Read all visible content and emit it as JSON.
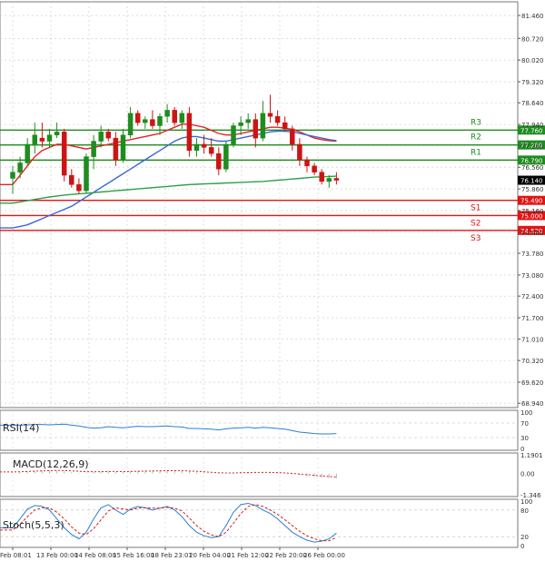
{
  "chart_data": {
    "type": "candlestick",
    "price_axis": {
      "ticks": [
        "81.460",
        "80.720",
        "80.020",
        "79.320",
        "78.640",
        "77.940",
        "77.260",
        "76.560",
        "75.860",
        "75.160",
        "74.460",
        "73.780",
        "73.080",
        "72.400",
        "71.700",
        "71.010",
        "70.320",
        "69.620",
        "68.940"
      ],
      "range": [
        68.94,
        81.46
      ]
    },
    "time_axis": {
      "labels": [
        "Feb 08:01",
        "13 Feb 00:00",
        "14 Feb 08:00",
        "15 Feb 16:00",
        "18 Feb 23:01",
        "20 Feb 04:00",
        "21 Feb 12:00",
        "22 Feb 20:00",
        "26 Feb 00:00"
      ]
    },
    "levels": [
      {
        "name": "R3",
        "value": 77.76,
        "label": "77.760",
        "color": "#1f8c1f"
      },
      {
        "name": "R2",
        "value": 77.28,
        "label": "77.280",
        "color": "#1f8c1f"
      },
      {
        "name": "R1",
        "value": 76.79,
        "label": "76.790",
        "color": "#1f8c1f"
      },
      {
        "name": "S1",
        "value": 75.49,
        "label": "75.490",
        "color": "#e01414"
      },
      {
        "name": "S2",
        "value": 75.0,
        "label": "75.000",
        "color": "#e01414"
      },
      {
        "name": "S3",
        "value": 74.52,
        "label": "74.520",
        "color": "#e01414"
      }
    ],
    "current_price": {
      "value": 76.14,
      "label": "76.140"
    },
    "candles": [
      {
        "o": 76.2,
        "h": 76.6,
        "l": 75.7,
        "c": 76.4
      },
      {
        "o": 76.4,
        "h": 76.9,
        "l": 76.2,
        "c": 76.7
      },
      {
        "o": 76.7,
        "h": 77.5,
        "l": 76.6,
        "c": 77.3
      },
      {
        "o": 77.3,
        "h": 78.0,
        "l": 77.0,
        "c": 77.6
      },
      {
        "o": 77.5,
        "h": 78.0,
        "l": 77.2,
        "c": 77.4
      },
      {
        "o": 77.4,
        "h": 77.8,
        "l": 77.2,
        "c": 77.6
      },
      {
        "o": 77.6,
        "h": 78.0,
        "l": 77.5,
        "c": 77.7
      },
      {
        "o": 77.7,
        "h": 77.8,
        "l": 76.1,
        "c": 76.3
      },
      {
        "o": 76.3,
        "h": 76.5,
        "l": 75.9,
        "c": 76.0
      },
      {
        "o": 76.0,
        "h": 76.2,
        "l": 75.7,
        "c": 75.8
      },
      {
        "o": 75.8,
        "h": 77.0,
        "l": 75.7,
        "c": 76.9
      },
      {
        "o": 76.9,
        "h": 77.6,
        "l": 76.5,
        "c": 77.4
      },
      {
        "o": 77.4,
        "h": 77.9,
        "l": 77.2,
        "c": 77.7
      },
      {
        "o": 77.7,
        "h": 77.8,
        "l": 77.4,
        "c": 77.5
      },
      {
        "o": 77.5,
        "h": 77.7,
        "l": 76.6,
        "c": 76.8
      },
      {
        "o": 76.8,
        "h": 77.8,
        "l": 76.7,
        "c": 77.6
      },
      {
        "o": 77.6,
        "h": 78.5,
        "l": 77.5,
        "c": 78.3
      },
      {
        "o": 78.3,
        "h": 78.4,
        "l": 77.9,
        "c": 78.0
      },
      {
        "o": 78.0,
        "h": 78.2,
        "l": 77.8,
        "c": 78.1
      },
      {
        "o": 78.1,
        "h": 78.4,
        "l": 77.8,
        "c": 77.9
      },
      {
        "o": 77.9,
        "h": 78.3,
        "l": 77.6,
        "c": 78.2
      },
      {
        "o": 78.2,
        "h": 78.6,
        "l": 78.0,
        "c": 78.4
      },
      {
        "o": 78.4,
        "h": 78.5,
        "l": 77.9,
        "c": 78.0
      },
      {
        "o": 78.0,
        "h": 78.4,
        "l": 77.8,
        "c": 78.3
      },
      {
        "o": 78.3,
        "h": 78.5,
        "l": 76.9,
        "c": 77.1
      },
      {
        "o": 77.1,
        "h": 77.5,
        "l": 76.9,
        "c": 77.3
      },
      {
        "o": 77.3,
        "h": 77.6,
        "l": 77.0,
        "c": 77.2
      },
      {
        "o": 77.2,
        "h": 77.5,
        "l": 76.9,
        "c": 77.0
      },
      {
        "o": 77.0,
        "h": 77.2,
        "l": 76.3,
        "c": 76.5
      },
      {
        "o": 76.5,
        "h": 77.4,
        "l": 76.4,
        "c": 77.3
      },
      {
        "o": 77.3,
        "h": 78.0,
        "l": 77.2,
        "c": 77.9
      },
      {
        "o": 77.9,
        "h": 78.2,
        "l": 77.6,
        "c": 78.0
      },
      {
        "o": 78.0,
        "h": 78.3,
        "l": 77.8,
        "c": 78.1
      },
      {
        "o": 78.1,
        "h": 78.3,
        "l": 77.2,
        "c": 77.5
      },
      {
        "o": 77.5,
        "h": 78.7,
        "l": 77.4,
        "c": 78.3
      },
      {
        "o": 78.3,
        "h": 78.9,
        "l": 78.0,
        "c": 78.2
      },
      {
        "o": 78.2,
        "h": 78.4,
        "l": 77.9,
        "c": 78.0
      },
      {
        "o": 78.0,
        "h": 78.2,
        "l": 77.7,
        "c": 77.8
      },
      {
        "o": 77.8,
        "h": 77.9,
        "l": 77.1,
        "c": 77.3
      },
      {
        "o": 77.3,
        "h": 77.5,
        "l": 76.6,
        "c": 76.8
      },
      {
        "o": 76.8,
        "h": 76.9,
        "l": 76.4,
        "c": 76.6
      },
      {
        "o": 76.6,
        "h": 76.7,
        "l": 76.3,
        "c": 76.4
      },
      {
        "o": 76.4,
        "h": 76.5,
        "l": 76.0,
        "c": 76.1
      },
      {
        "o": 76.1,
        "h": 76.3,
        "l": 75.9,
        "c": 76.2
      },
      {
        "o": 76.2,
        "h": 76.4,
        "l": 76.0,
        "c": 76.14
      }
    ],
    "moving_averages": [
      {
        "color": "#e22222",
        "values": [
          76.0,
          76.3,
          76.6,
          76.9,
          77.1,
          77.2,
          77.3,
          77.3,
          77.25,
          77.2,
          77.15,
          77.2,
          77.25,
          77.3,
          77.35,
          77.4,
          77.45,
          77.5,
          77.55,
          77.6,
          77.65,
          77.75,
          77.85,
          77.95,
          77.95,
          77.9,
          77.85,
          77.75,
          77.65,
          77.6,
          77.6,
          77.65,
          77.7,
          77.75,
          77.8,
          77.85,
          77.85,
          77.82,
          77.78,
          77.7,
          77.6,
          77.5,
          77.45,
          77.42,
          77.4
        ]
      },
      {
        "color": "#3a66d8",
        "values": [
          74.6,
          74.65,
          74.7,
          74.8,
          74.9,
          75.0,
          75.1,
          75.2,
          75.3,
          75.45,
          75.6,
          75.75,
          75.9,
          76.05,
          76.2,
          76.35,
          76.5,
          76.65,
          76.8,
          76.95,
          77.1,
          77.25,
          77.4,
          77.5,
          77.55,
          77.55,
          77.5,
          77.45,
          77.4,
          77.4,
          77.45,
          77.5,
          77.55,
          77.6,
          77.65,
          77.7,
          77.72,
          77.72,
          77.7,
          77.65,
          77.6,
          77.55,
          77.5,
          77.45,
          77.42
        ]
      },
      {
        "color": "#2e9e4a",
        "values": [
          75.4,
          75.44,
          75.48,
          75.52,
          75.56,
          75.6,
          75.63,
          75.66,
          75.68,
          75.7,
          75.72,
          75.74,
          75.76,
          75.78,
          75.8,
          75.82,
          75.84,
          75.86,
          75.88,
          75.9,
          75.92,
          75.94,
          75.96,
          75.98,
          76.0,
          76.01,
          76.02,
          76.03,
          76.04,
          76.05,
          76.06,
          76.07,
          76.08,
          76.09,
          76.1,
          76.12,
          76.14,
          76.16,
          76.18,
          76.2,
          76.22,
          76.24,
          76.25,
          76.26,
          76.27
        ]
      }
    ],
    "rsi": {
      "label": "RSI(14)",
      "axis_ticks": [
        "100",
        "70",
        "30",
        "0"
      ],
      "levels": [
        70,
        30
      ],
      "values": [
        64,
        64,
        65,
        66,
        66,
        65,
        66,
        67,
        64,
        62,
        58,
        56,
        57,
        60,
        58,
        57,
        59,
        61,
        60,
        60,
        61,
        62,
        60,
        59,
        55,
        55,
        54,
        53,
        51,
        54,
        56,
        57,
        58,
        56,
        58,
        57,
        55,
        53,
        49,
        45,
        43,
        41,
        40,
        40,
        41
      ]
    },
    "macd": {
      "label": "MACD(12,26,9)",
      "axis_ticks": [
        "1.1901",
        "0.00",
        "-1.346"
      ],
      "histogram": [
        0.05,
        0.08,
        0.12,
        0.18,
        0.2,
        0.22,
        0.2,
        0.15,
        0.08,
        0.04,
        0.06,
        0.1,
        0.14,
        0.16,
        0.12,
        0.1,
        0.14,
        0.18,
        0.2,
        0.2,
        0.21,
        0.22,
        0.2,
        0.18,
        0.12,
        0.08,
        0.05,
        0.02,
        -0.02,
        0.0,
        0.05,
        0.08,
        0.1,
        0.08,
        0.1,
        0.09,
        0.06,
        0.02,
        -0.05,
        -0.12,
        -0.18,
        -0.22,
        -0.26,
        -0.28,
        -0.3
      ],
      "signal": [
        0.1,
        0.11,
        0.13,
        0.15,
        0.17,
        0.19,
        0.2,
        0.19,
        0.17,
        0.14,
        0.12,
        0.11,
        0.12,
        0.13,
        0.13,
        0.12,
        0.13,
        0.14,
        0.15,
        0.16,
        0.17,
        0.18,
        0.18,
        0.18,
        0.16,
        0.14,
        0.11,
        0.08,
        0.05,
        0.04,
        0.04,
        0.05,
        0.06,
        0.07,
        0.07,
        0.07,
        0.06,
        0.04,
        0.01,
        -0.03,
        -0.07,
        -0.11,
        -0.15,
        -0.19,
        -0.22
      ]
    },
    "stochastic": {
      "label": "Stoch(5,5,3)",
      "axis_ticks": [
        "100",
        "80",
        "20",
        "0"
      ],
      "levels": [
        80,
        20
      ],
      "k": [
        40,
        60,
        82,
        90,
        88,
        80,
        60,
        40,
        25,
        15,
        30,
        60,
        85,
        92,
        80,
        70,
        82,
        88,
        85,
        80,
        84,
        88,
        80,
        65,
        45,
        30,
        22,
        18,
        20,
        45,
        75,
        92,
        95,
        90,
        80,
        72,
        60,
        45,
        30,
        20,
        12,
        8,
        10,
        15,
        28
      ],
      "d": [
        35,
        48,
        65,
        80,
        85,
        85,
        75,
        60,
        42,
        28,
        25,
        38,
        58,
        78,
        85,
        82,
        80,
        84,
        85,
        84,
        84,
        86,
        84,
        78,
        62,
        45,
        32,
        24,
        20,
        30,
        50,
        72,
        88,
        92,
        88,
        80,
        70,
        58,
        45,
        32,
        22,
        15,
        11,
        11,
        18
      ]
    }
  }
}
